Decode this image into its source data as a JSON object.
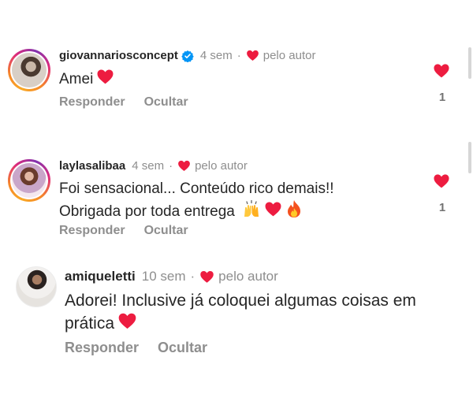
{
  "comments": [
    {
      "username": "giovannariosconcept",
      "verified": true,
      "time": "4 sem",
      "liked_by_author": "pelo autor",
      "text_lines": [
        "Amei"
      ],
      "text_emojis": [
        "heart-emoji"
      ],
      "reply_label": "Responder",
      "hide_label": "Ocultar",
      "like_count": "1",
      "avatar_story_ring": true
    },
    {
      "username": "laylasalibaa",
      "verified": false,
      "time": "4 sem",
      "liked_by_author": "pelo autor",
      "text_lines": [
        "Foi sensacional... Conteúdo rico demais!!",
        "Obrigada por toda entrega"
      ],
      "text_emojis": [
        "raising-hands-emoji",
        "heart-emoji",
        "fire-emoji"
      ],
      "reply_label": "Responder",
      "hide_label": "Ocultar",
      "like_count": "1",
      "avatar_story_ring": true
    },
    {
      "username": "amiqueletti",
      "verified": false,
      "time": "10 sem",
      "liked_by_author": "pelo autor",
      "text_lines": [
        "Adorei! Inclusive já coloquei algumas coisas  em",
        "prática"
      ],
      "text_emojis": [
        "heart-emoji"
      ],
      "reply_label": "Responder",
      "hide_label": "Ocultar",
      "avatar_story_ring": false
    }
  ],
  "separator": "·",
  "colors": {
    "heart": "#ed1c40",
    "verified_badge": "#0095f6",
    "muted_text": "#8e8e8e",
    "primary_text": "#262626"
  }
}
